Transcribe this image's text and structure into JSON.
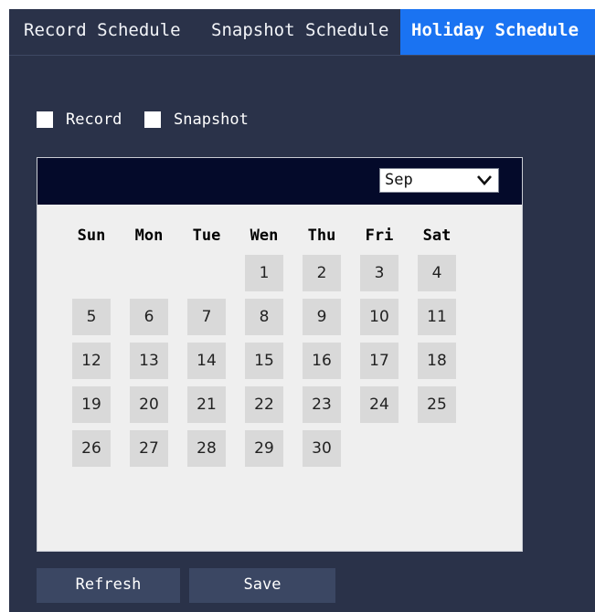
{
  "tabs": [
    {
      "label": "Record Schedule"
    },
    {
      "label": "Snapshot Schedule"
    },
    {
      "label": "Holiday Schedule"
    }
  ],
  "active_tab": "Holiday Schedule",
  "checkboxes": [
    {
      "label": "Record",
      "checked": false
    },
    {
      "label": "Snapshot",
      "checked": false
    }
  ],
  "calendar": {
    "month": "Sep",
    "weekdays": [
      "Sun",
      "Mon",
      "Tue",
      "Wen",
      "Thu",
      "Fri",
      "Sat"
    ],
    "first_weekday_index": 3,
    "days": [
      "1",
      "2",
      "3",
      "4",
      "5",
      "6",
      "7",
      "8",
      "9",
      "10",
      "11",
      "12",
      "13",
      "14",
      "15",
      "16",
      "17",
      "18",
      "19",
      "20",
      "21",
      "22",
      "23",
      "24",
      "25",
      "26",
      "27",
      "28",
      "29",
      "30"
    ]
  },
  "buttons": {
    "refresh_label": "Refresh",
    "save_label": "Save"
  },
  "colors": {
    "background": "#2a3249",
    "active_tab": "#1a73f2",
    "calendar_header": "#040a2a",
    "day_cell": "#d9d9d9"
  }
}
